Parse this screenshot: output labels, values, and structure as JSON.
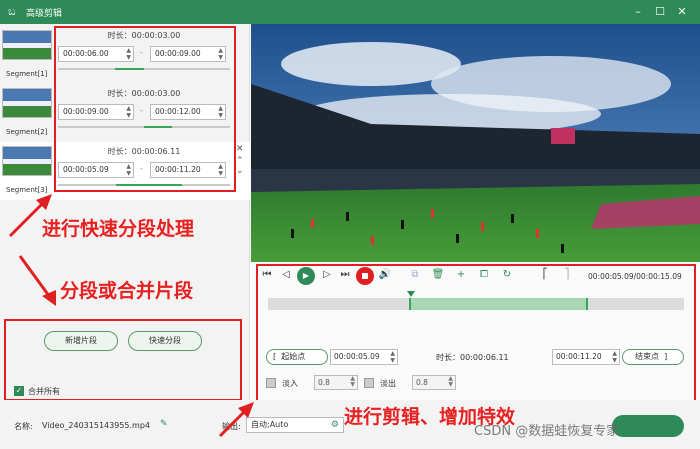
{
  "window": {
    "title": "高级剪辑",
    "controls": [
      "minimize-icon",
      "maximize-icon",
      "close-icon"
    ]
  },
  "segments": [
    {
      "name": "Segment[1]",
      "duration_label": "时长：00:00:03.00",
      "start": "00:00:06.00",
      "end": "00:00:09.00",
      "fill_start": 0.33,
      "fill_end": 0.5
    },
    {
      "name": "Segment[2]",
      "duration_label": "时长：00:00:03.00",
      "start": "00:00:09.00",
      "end": "00:00:12.00",
      "fill_start": 0.5,
      "fill_end": 0.66
    },
    {
      "name": "Segment[3]",
      "duration_label": "时长：00:00:06.11",
      "start": "00:00:05.09",
      "end": "00:00:11.20",
      "fill_start": 0.34,
      "fill_end": 0.72
    }
  ],
  "annotations": {
    "fast_segment": "进行快速分段处理",
    "segment_or_merge": "分段或合并片段",
    "edit_effects": "进行剪辑、增加特效"
  },
  "buttons": {
    "new_segment": "新增片段",
    "fast_segment": "快速分段",
    "merge_all": "合并所有",
    "start_point": "起始点",
    "end_point": "结束点"
  },
  "bottom": {
    "name_label": "名称:",
    "name_value": "Video_240315143955.mp4",
    "output_label": "输出:",
    "output_value": "自动;Auto"
  },
  "player": {
    "time_display": "00:00:05.09/00:00:15.09",
    "selection_start": 0.34,
    "selection_end": 0.77
  },
  "trim": {
    "start_value": "00:00:05.09",
    "duration_label": "时长：00:00:06.11",
    "end_value": "00:00:11.20"
  },
  "effects": {
    "fade_in_label": "淡入",
    "fade_in_value": "0.8",
    "fade_out_label": "淡出",
    "fade_out_value": "0.8"
  },
  "watermark": "CSDN @数据蛙恢复专家",
  "colors": {
    "brand": "#2e8b57",
    "annotation": "#e02020"
  }
}
